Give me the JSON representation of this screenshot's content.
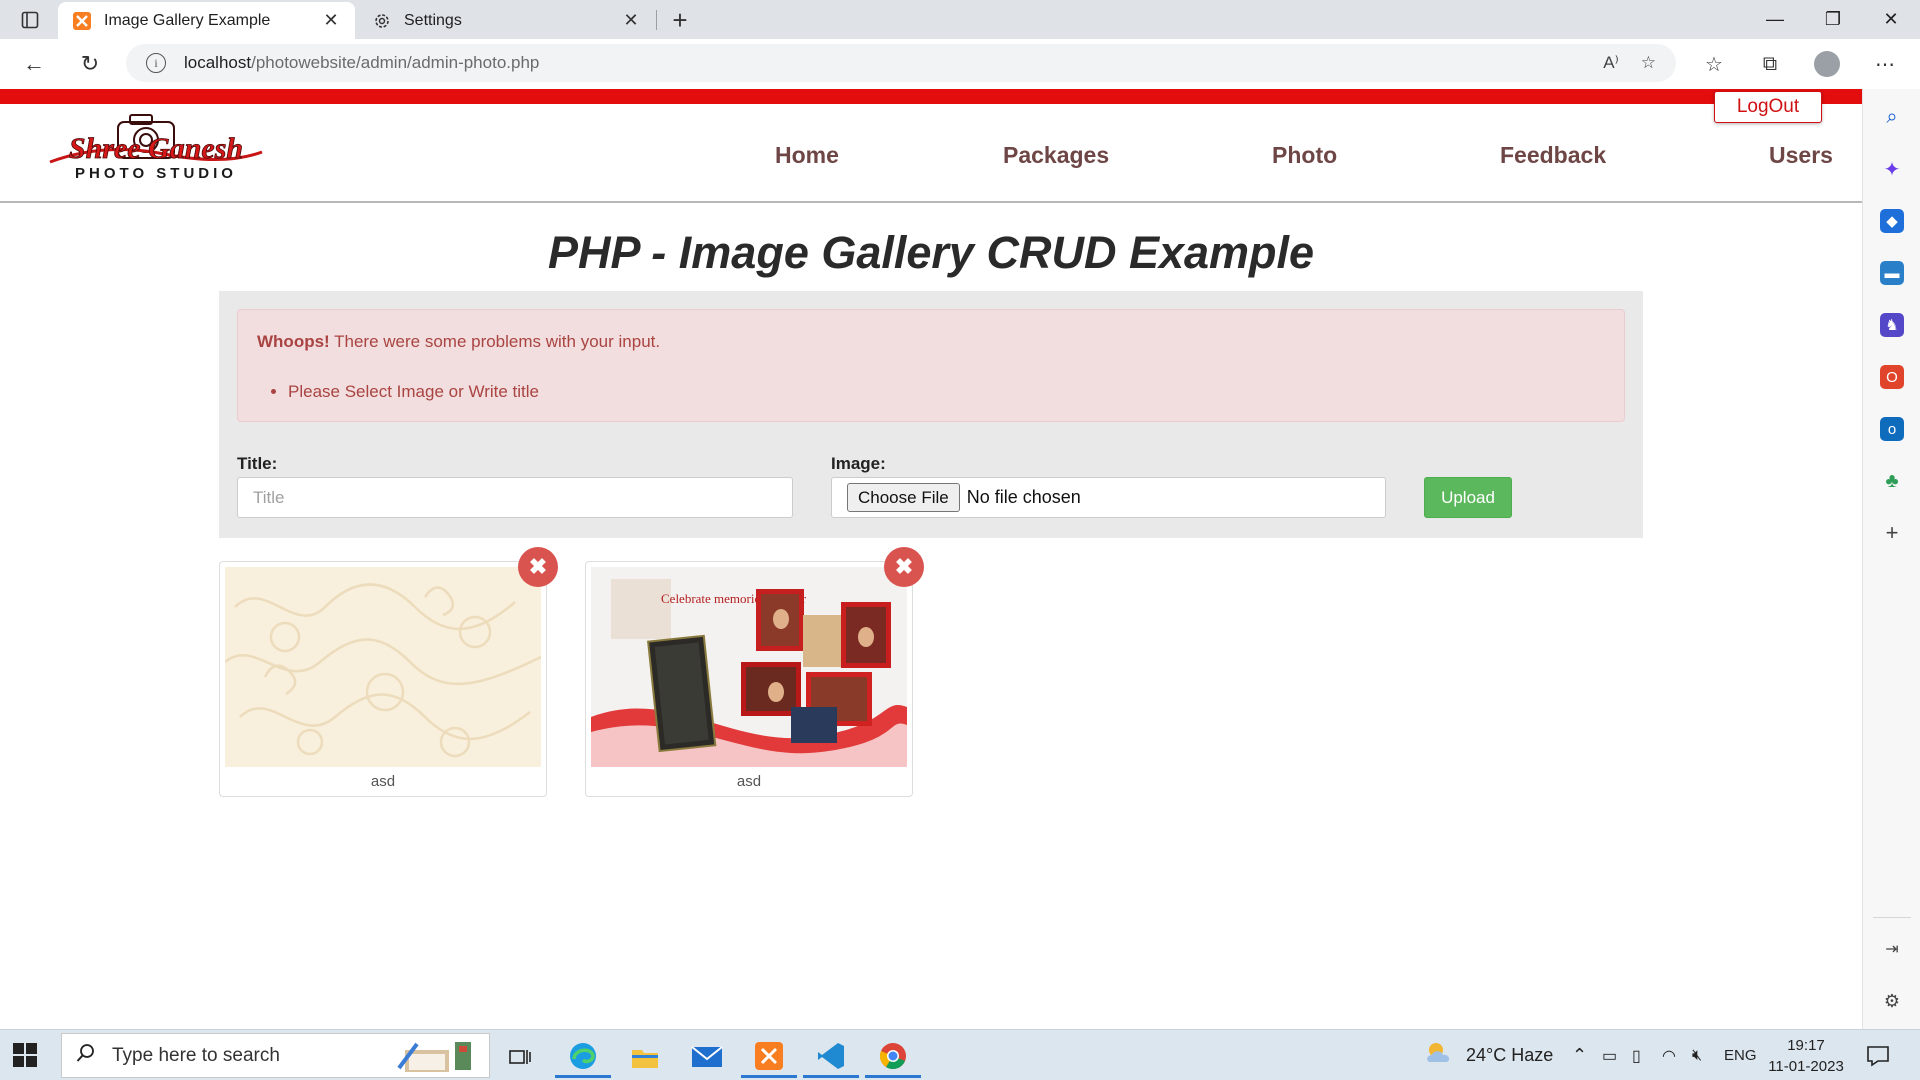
{
  "browser": {
    "tabs": [
      {
        "title": "Image Gallery Example",
        "active": true,
        "icon": "xampp-icon"
      },
      {
        "title": "Settings",
        "active": false,
        "icon": "gear-icon"
      }
    ],
    "url": {
      "host": "localhost",
      "path": "/photowebsite/admin/admin-photo.php"
    }
  },
  "site": {
    "logout_label": "LogOut",
    "logo": {
      "line1": "Shree Ganesh",
      "line2": "PHOTO STUDIO"
    },
    "nav": [
      "Home",
      "Packages",
      "Photo",
      "Feedback",
      "Users"
    ]
  },
  "page": {
    "title": "PHP - Image Gallery CRUD Example",
    "alert": {
      "strong": "Whoops!",
      "message": " There were some problems with your input.",
      "errors": [
        "Please Select Image or Write title"
      ]
    },
    "form": {
      "title_label": "Title:",
      "title_placeholder": "Title",
      "image_label": "Image:",
      "choose_label": "Choose File",
      "no_file_label": "No file chosen",
      "upload_label": "Upload"
    },
    "gallery": [
      {
        "caption": "asd",
        "image": "pattern"
      },
      {
        "caption": "asd",
        "image": "photo-albums",
        "overlay_text": "Celebrate memories forever"
      }
    ],
    "delete_glyph": "✖"
  },
  "taskbar": {
    "search_placeholder": "Type here to search",
    "weather": "24°C  Haze",
    "language": "ENG",
    "time": "19:17",
    "date": "11-01-2023"
  },
  "colors": {
    "red_bar": "#e30d0d",
    "nav_text": "#6e4646",
    "alert_bg": "#f2dede",
    "alert_text": "#a94442",
    "upload_green": "#5cb85c",
    "delete_red": "#d9534f"
  }
}
